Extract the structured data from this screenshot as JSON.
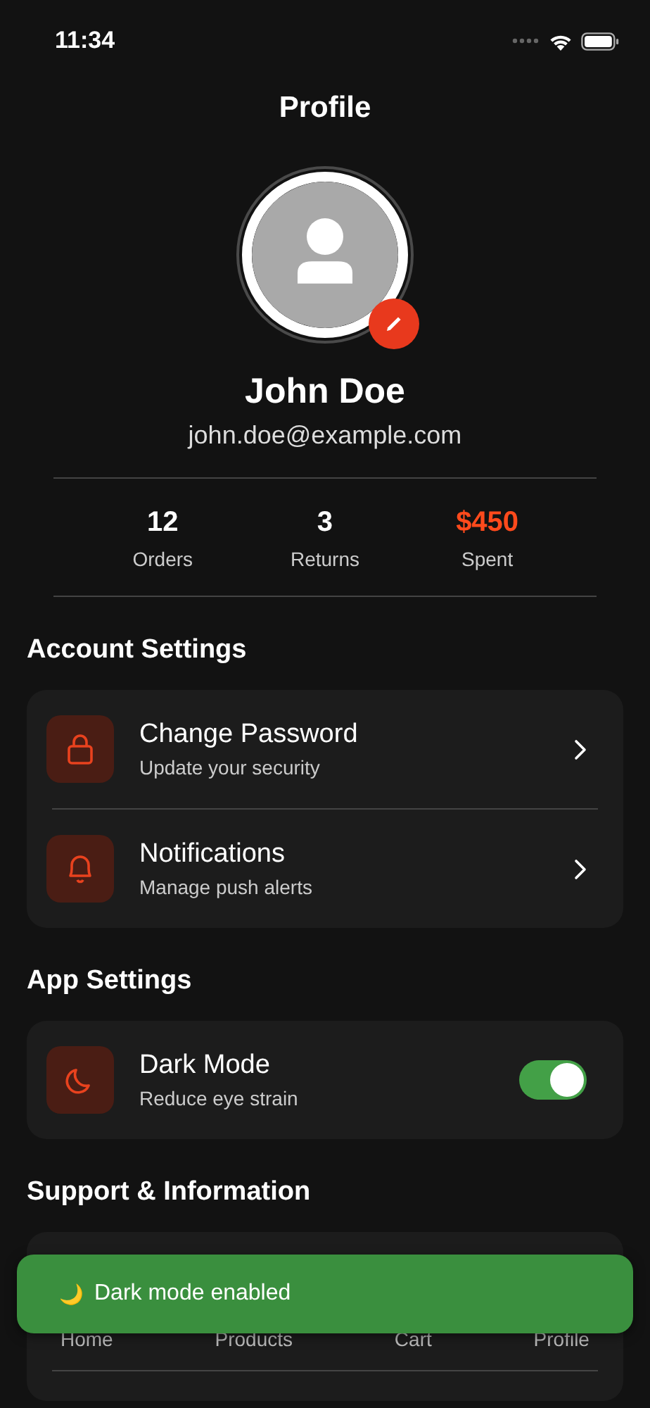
{
  "status_bar": {
    "time": "11:34"
  },
  "header": {
    "title": "Profile"
  },
  "profile": {
    "name": "John Doe",
    "email": "john.doe@example.com"
  },
  "stats": [
    {
      "value": "12",
      "label": "Orders",
      "highlight": false
    },
    {
      "value": "3",
      "label": "Returns",
      "highlight": false
    },
    {
      "value": "$450",
      "label": "Spent",
      "highlight": true
    }
  ],
  "sections": [
    {
      "title": "Account Settings",
      "items": [
        {
          "kind": "password",
          "title": "Change Password",
          "subtitle": "Update your security"
        },
        {
          "kind": "notifications",
          "title": "Notifications",
          "subtitle": "Manage push alerts"
        }
      ]
    },
    {
      "title": "App Settings",
      "items": [
        {
          "kind": "dark-mode",
          "title": "Dark Mode",
          "subtitle": "Reduce eye strain",
          "on": true
        }
      ]
    },
    {
      "title": "Support & Information"
    }
  ],
  "tab_bar": [
    {
      "label": "Home"
    },
    {
      "label": "Products"
    },
    {
      "label": "Cart"
    },
    {
      "label": "Profile"
    }
  ],
  "toast": {
    "icon": "🌙",
    "message": "Dark mode enabled"
  }
}
